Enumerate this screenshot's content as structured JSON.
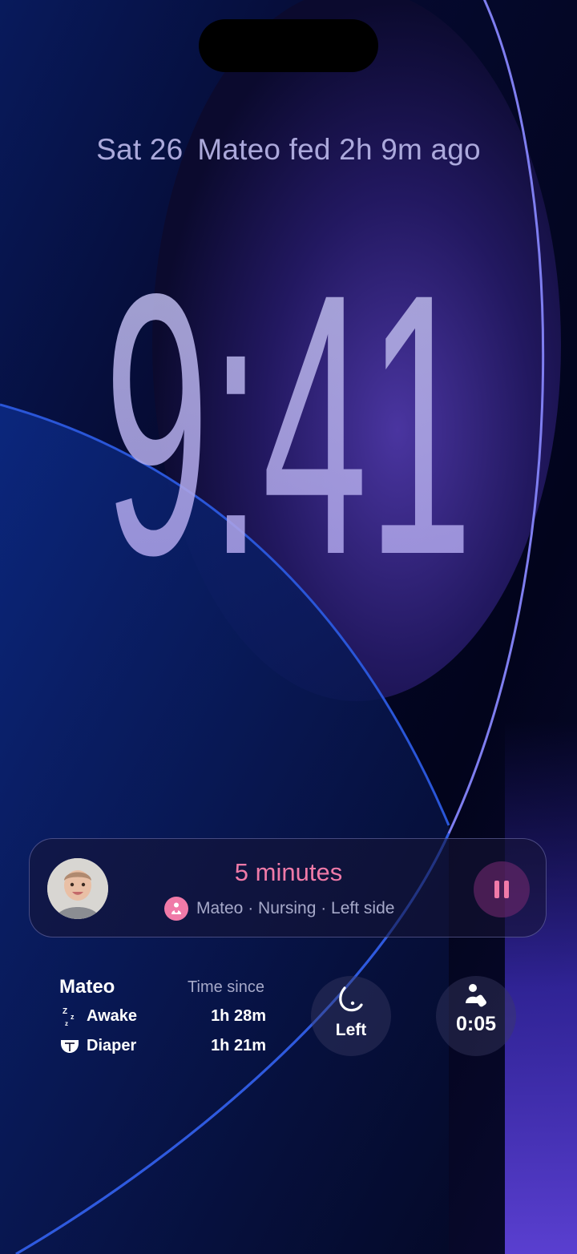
{
  "lock_screen": {
    "date": "Sat 26",
    "feed_status": "Mateo fed 2h 9m ago",
    "time": "9:41"
  },
  "live_activity": {
    "timer": "5 minutes",
    "subtitle": "Mateo · Nursing · Left side",
    "avatar_icon": "baby-photo",
    "feed_icon": "nursing-icon",
    "pause_icon": "pause-icon",
    "accent_color": "#f07aa8"
  },
  "widgets": {
    "summary": {
      "name": "Mateo",
      "header": "Time since",
      "rows": [
        {
          "icon": "sleep-icon",
          "label": "Awake",
          "value": "1h 28m"
        },
        {
          "icon": "diaper-icon",
          "label": "Diaper",
          "value": "1h 21m"
        }
      ]
    },
    "side": {
      "icon": "breast-icon",
      "label": "Left"
    },
    "feed_timer": {
      "icon": "bottle-icon",
      "label": "0:05"
    }
  }
}
